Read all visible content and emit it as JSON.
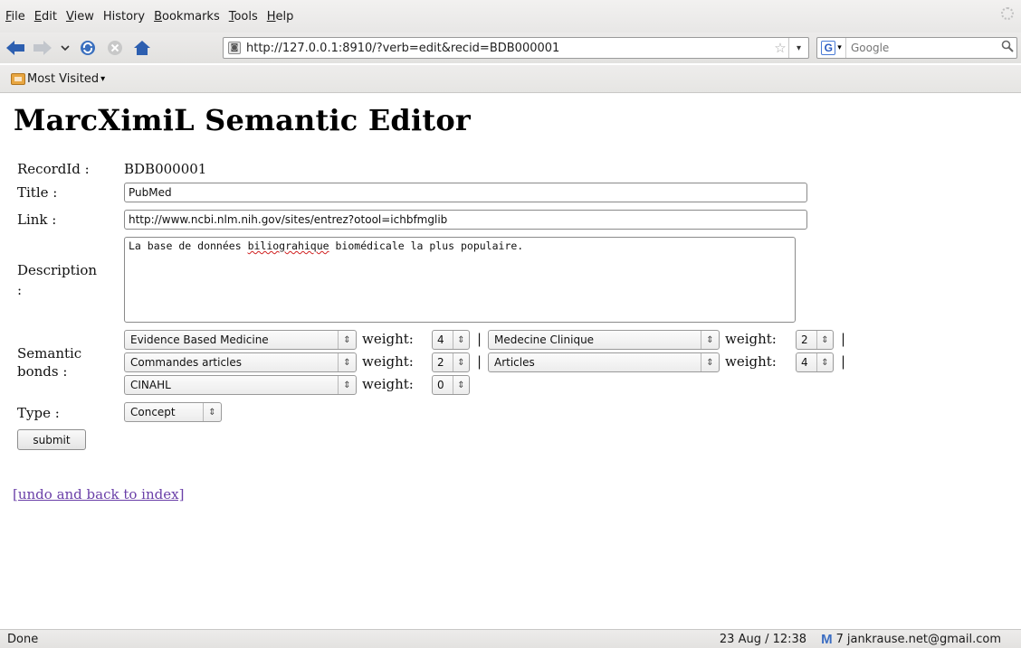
{
  "menu": {
    "items": [
      {
        "key": "F",
        "rest": "ile"
      },
      {
        "key": "E",
        "rest": "dit"
      },
      {
        "key": "V",
        "rest": "iew"
      },
      {
        "key": "Hi",
        "rest": "story",
        "pre": true
      },
      {
        "key": "B",
        "rest": "ookmarks"
      },
      {
        "key": "T",
        "rest": "ools"
      },
      {
        "key": "H",
        "rest": "elp"
      }
    ],
    "labels": [
      "File",
      "Edit",
      "View",
      "History",
      "Bookmarks",
      "Tools",
      "Help"
    ]
  },
  "toolbar": {
    "url": "http://127.0.0.1:8910/?verb=edit&recid=BDB000001",
    "search_placeholder": "Google"
  },
  "bookmarks": {
    "most_visited": "Most Visited"
  },
  "page": {
    "title": "MarcXimiL Semantic Editor",
    "record_label": "RecordId :",
    "record_value": "BDB000001",
    "title_label": "Title :",
    "title_value": "PubMed",
    "link_label": "Link :",
    "link_value": "http://www.ncbi.nlm.nih.gov/sites/entrez?otool=ichbfmglib",
    "description_label_1": "Description",
    "description_label_2": ":",
    "description_before": "La base de données ",
    "description_misspelled": "biliograhique",
    "description_after": " biomédicale la plus populaire.",
    "semantic_label_1": "Semantic",
    "semantic_label_2": "bonds :",
    "weight_label": "weight:",
    "bonds": [
      {
        "name": "Evidence Based Medicine",
        "weight": "4"
      },
      {
        "name": "Medecine Clinique",
        "weight": "2"
      },
      {
        "name": "Commandes articles",
        "weight": "2"
      },
      {
        "name": "Articles",
        "weight": "4"
      },
      {
        "name": "CINAHL",
        "weight": "0"
      }
    ],
    "type_label": "Type :",
    "type_value": "Concept",
    "submit_label": "submit",
    "back_link": "[undo and back to index]"
  },
  "status": {
    "text": "Done",
    "datetime": "23 Aug / 12:38",
    "mail_count": "7",
    "mail_account": "jankrause.net@gmail.com"
  },
  "colors": {
    "link_visited": "#6a3fa8",
    "nav_arrow": "#2d5fb0"
  }
}
